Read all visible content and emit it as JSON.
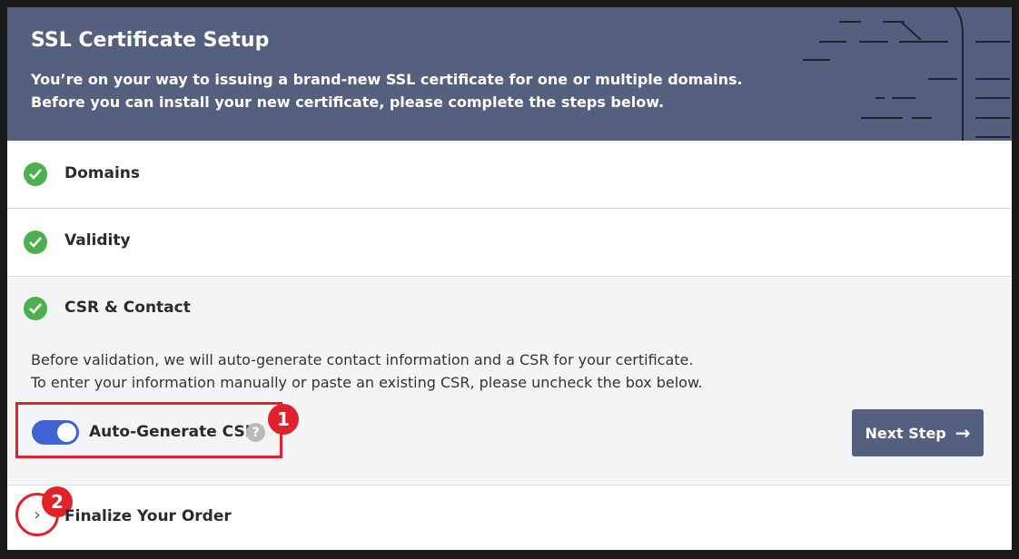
{
  "colors": {
    "header_bg": "#555f7e",
    "check": "#4caf50",
    "toggle": "#3f63d6",
    "annotation": "#e0232b"
  },
  "header": {
    "title": "SSL Certificate Setup",
    "desc_line1": "You’re on your way to issuing a brand-new SSL certificate for one or multiple domains.",
    "desc_line2": "Before you can install your new certificate, please complete the steps below."
  },
  "steps": {
    "domains": "Domains",
    "validity": "Validity",
    "csr": "CSR & Contact",
    "finalize": "Finalize Your Order"
  },
  "csr": {
    "desc_line1": "Before validation, we will auto-generate contact information and a CSR for your certificate.",
    "desc_line2": "To enter your information manually or paste an existing CSR, please uncheck the box below.",
    "toggle_label": "Auto-Generate CSR",
    "toggle_on": true,
    "help_glyph": "?",
    "next_label": "Next Step",
    "next_arrow": "→"
  },
  "annotations": {
    "badge1": "1",
    "badge2": "2"
  },
  "icons": {
    "check": "check-icon",
    "chevron": "chevron-right-icon",
    "help": "question-icon"
  }
}
